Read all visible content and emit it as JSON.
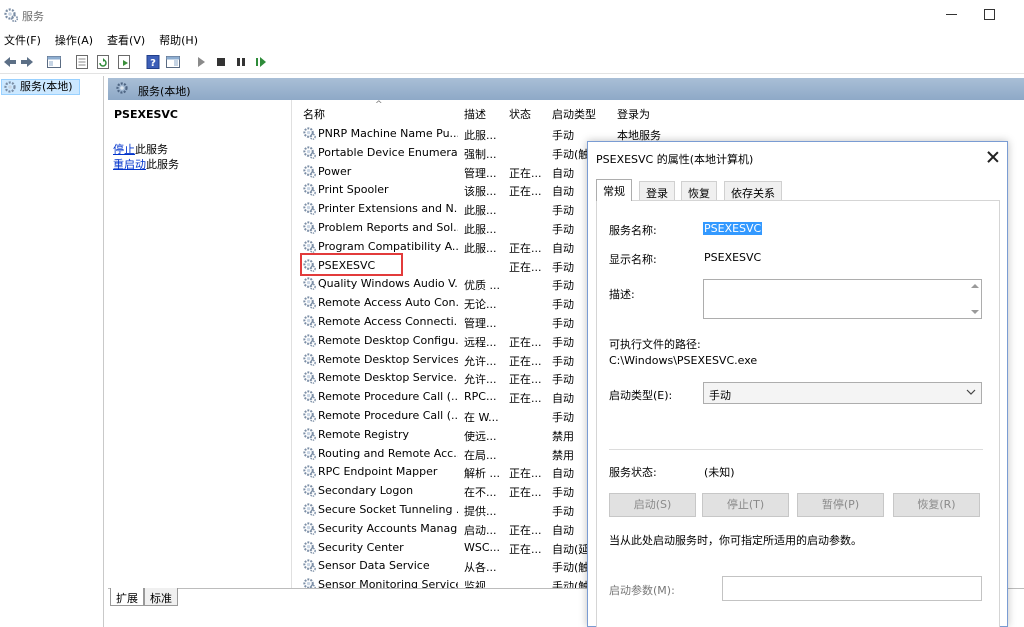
{
  "window": {
    "title": "服务"
  },
  "menu": [
    "文件(F)",
    "操作(A)",
    "查看(V)",
    "帮助(H)"
  ],
  "tree": {
    "root_label": "服务(本地)"
  },
  "pane": {
    "title": "服务(本地)"
  },
  "detail": {
    "service_name": "PSEXESVC",
    "stop_link": "停止",
    "stop_suffix": "此服务",
    "restart_link": "重启动",
    "restart_suffix": "此服务"
  },
  "columns": {
    "name": "名称",
    "desc": "描述",
    "state": "状态",
    "start": "启动类型",
    "logon": "登录为"
  },
  "services": [
    {
      "name": "PNRP Machine Name Pu...",
      "desc": "此服...",
      "state": "",
      "start": "手动",
      "logon": "本地服务"
    },
    {
      "name": "Portable Device Enumera...",
      "desc": "强制...",
      "state": "",
      "start": "手动(触",
      "logon": ""
    },
    {
      "name": "Power",
      "desc": "管理...",
      "state": "正在...",
      "start": "自动",
      "logon": ""
    },
    {
      "name": "Print Spooler",
      "desc": "该服...",
      "state": "正在...",
      "start": "自动",
      "logon": ""
    },
    {
      "name": "Printer Extensions and N...",
      "desc": "此服...",
      "state": "",
      "start": "手动",
      "logon": ""
    },
    {
      "name": "Problem Reports and Sol...",
      "desc": "此服...",
      "state": "",
      "start": "手动",
      "logon": ""
    },
    {
      "name": "Program Compatibility A...",
      "desc": "此服...",
      "state": "正在...",
      "start": "自动",
      "logon": ""
    },
    {
      "name": "PSEXESVC",
      "desc": "",
      "state": "正在...",
      "start": "手动",
      "logon": ""
    },
    {
      "name": "Quality Windows Audio V...",
      "desc": "优质 ...",
      "state": "",
      "start": "手动",
      "logon": ""
    },
    {
      "name": "Remote Access Auto Con...",
      "desc": "无论...",
      "state": "",
      "start": "手动",
      "logon": ""
    },
    {
      "name": "Remote Access Connecti...",
      "desc": "管理...",
      "state": "",
      "start": "手动",
      "logon": ""
    },
    {
      "name": "Remote Desktop Configu...",
      "desc": "远程...",
      "state": "正在...",
      "start": "手动",
      "logon": ""
    },
    {
      "name": "Remote Desktop Services",
      "desc": "允许...",
      "state": "正在...",
      "start": "手动",
      "logon": ""
    },
    {
      "name": "Remote Desktop Service...",
      "desc": "允许...",
      "state": "正在...",
      "start": "手动",
      "logon": ""
    },
    {
      "name": "Remote Procedure Call (...",
      "desc": "RPC...",
      "state": "正在...",
      "start": "自动",
      "logon": ""
    },
    {
      "name": "Remote Procedure Call (...",
      "desc": "在 W...",
      "state": "",
      "start": "手动",
      "logon": ""
    },
    {
      "name": "Remote Registry",
      "desc": "使远...",
      "state": "",
      "start": "禁用",
      "logon": ""
    },
    {
      "name": "Routing and Remote Acc...",
      "desc": "在局...",
      "state": "",
      "start": "禁用",
      "logon": ""
    },
    {
      "name": "RPC Endpoint Mapper",
      "desc": "解析 ...",
      "state": "正在...",
      "start": "自动",
      "logon": ""
    },
    {
      "name": "Secondary Logon",
      "desc": "在不...",
      "state": "正在...",
      "start": "手动",
      "logon": ""
    },
    {
      "name": "Secure Socket Tunneling ...",
      "desc": "提供...",
      "state": "",
      "start": "手动",
      "logon": ""
    },
    {
      "name": "Security Accounts Manag...",
      "desc": "启动...",
      "state": "正在...",
      "start": "自动",
      "logon": ""
    },
    {
      "name": "Security Center",
      "desc": "WSC...",
      "state": "正在...",
      "start": "自动(延",
      "logon": ""
    },
    {
      "name": "Sensor Data Service",
      "desc": "从各...",
      "state": "",
      "start": "手动(触",
      "logon": ""
    },
    {
      "name": "Sensor Monitoring Service",
      "desc": "监视...",
      "state": "",
      "start": "手动(触",
      "logon": ""
    }
  ],
  "bottom_tabs": [
    "扩展",
    "标准"
  ],
  "dialog": {
    "title": "PSEXESVC 的属性(本地计算机)",
    "tabs": [
      "常规",
      "登录",
      "恢复",
      "依存关系"
    ],
    "service_name_label": "服务名称:",
    "service_name_value": "PSEXESVC",
    "display_name_label": "显示名称:",
    "display_name_value": "PSEXESVC",
    "description_label": "描述:",
    "path_label": "可执行文件的路径:",
    "path_value": "C:\\Windows\\PSEXESVC.exe",
    "startup_type_label": "启动类型(E):",
    "startup_type_value": "手动",
    "status_label": "服务状态:",
    "status_value": "(未知)",
    "buttons": [
      "启动(S)",
      "停止(T)",
      "暂停(P)",
      "恢复(R)"
    ],
    "hint": "当从此处启动服务时，你可指定所适用的启动参数。",
    "params_label": "启动参数(M):"
  }
}
